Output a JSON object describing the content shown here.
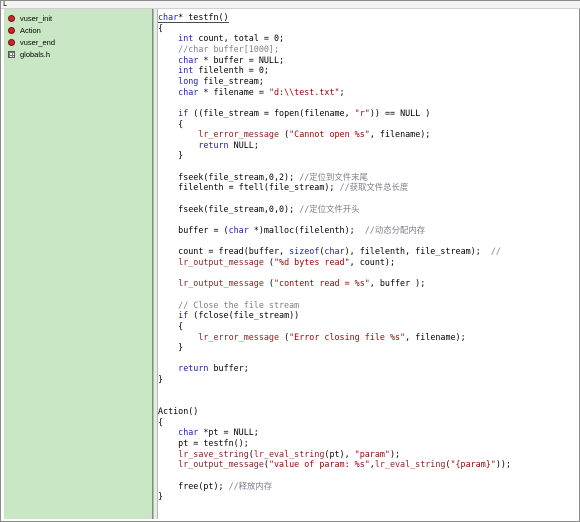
{
  "window": {
    "top_mark": "L"
  },
  "sidebar": {
    "items": [
      {
        "label": "vuser_init",
        "icon": "red-action-icon"
      },
      {
        "label": "Action",
        "icon": "red-action-icon"
      },
      {
        "label": "vuser_end",
        "icon": "red-action-icon"
      },
      {
        "label": "globals.h",
        "icon": "header-file-icon"
      }
    ]
  },
  "editor": {
    "colors": {
      "keyword": "#1b1bb3",
      "string": "#9a0000",
      "comment": "#7f7f8c",
      "function": "#8b1e1e",
      "sidebar_bg": "#c9e7c4"
    },
    "lines": [
      {
        "segments": [
          [
            "kw",
            "char"
          ],
          [
            "",
            "* testfn()"
          ]
        ]
      },
      {
        "segments": [
          [
            "",
            "{"
          ]
        ]
      },
      {
        "segments": [
          [
            "",
            "    "
          ],
          [
            "kw",
            "int"
          ],
          [
            "",
            " count, total = 0;"
          ]
        ]
      },
      {
        "segments": [
          [
            "",
            "    "
          ],
          [
            "cm",
            "//char buffer[1000];"
          ]
        ]
      },
      {
        "segments": [
          [
            "",
            "    "
          ],
          [
            "kw",
            "char"
          ],
          [
            "",
            " * buffer = NULL;"
          ]
        ]
      },
      {
        "segments": [
          [
            "",
            "    "
          ],
          [
            "kw",
            "int"
          ],
          [
            "",
            " filelenth = 0;"
          ]
        ]
      },
      {
        "segments": [
          [
            "",
            "    "
          ],
          [
            "kw",
            "long"
          ],
          [
            "",
            " file_stream;"
          ]
        ]
      },
      {
        "segments": [
          [
            "",
            "    "
          ],
          [
            "kw",
            "char"
          ],
          [
            "",
            " * filename = "
          ],
          [
            "str",
            "\"d:\\\\test.txt\""
          ],
          [
            "",
            ";"
          ]
        ]
      },
      {
        "segments": [
          [
            "",
            ""
          ]
        ]
      },
      {
        "segments": [
          [
            "",
            "    "
          ],
          [
            "kw",
            "if"
          ],
          [
            "",
            " ((file_stream = fopen(filename, "
          ],
          [
            "str",
            "\"r\""
          ],
          [
            "",
            ")) == NULL )"
          ]
        ]
      },
      {
        "segments": [
          [
            "",
            "    {"
          ]
        ]
      },
      {
        "segments": [
          [
            "",
            "        "
          ],
          [
            "fn",
            "lr_error_message"
          ],
          [
            "",
            " ("
          ],
          [
            "str",
            "\"Cannot open %s\""
          ],
          [
            "",
            ", filename);"
          ]
        ]
      },
      {
        "segments": [
          [
            "",
            "        "
          ],
          [
            "kw",
            "return"
          ],
          [
            "",
            " NULL;"
          ]
        ]
      },
      {
        "segments": [
          [
            "",
            "    }"
          ]
        ]
      },
      {
        "segments": [
          [
            "",
            ""
          ]
        ]
      },
      {
        "segments": [
          [
            "",
            "    fseek(file_stream,0,2); "
          ],
          [
            "cm",
            "//定位到文件末尾"
          ]
        ]
      },
      {
        "segments": [
          [
            "",
            "    filelenth = ftell(file_stream); "
          ],
          [
            "cm",
            "//获取文件总长度"
          ]
        ]
      },
      {
        "segments": [
          [
            "",
            ""
          ]
        ]
      },
      {
        "segments": [
          [
            "",
            "    fseek(file_stream,0,0); "
          ],
          [
            "cm",
            "//定位文件开头"
          ]
        ]
      },
      {
        "segments": [
          [
            "",
            ""
          ]
        ]
      },
      {
        "segments": [
          [
            "",
            "    buffer = ("
          ],
          [
            "kw",
            "char"
          ],
          [
            "",
            " *)malloc(filelenth);  "
          ],
          [
            "cm",
            "//动态分配内存"
          ]
        ]
      },
      {
        "segments": [
          [
            "",
            ""
          ]
        ]
      },
      {
        "segments": [
          [
            "",
            "    count = fread(buffer, "
          ],
          [
            "kw",
            "sizeof"
          ],
          [
            "",
            "("
          ],
          [
            "kw",
            "char"
          ],
          [
            "",
            "), filelenth, file_stream);  "
          ],
          [
            "cm",
            "//"
          ]
        ]
      },
      {
        "segments": [
          [
            "",
            "    "
          ],
          [
            "fn",
            "lr_output_message"
          ],
          [
            "",
            " ("
          ],
          [
            "str",
            "\"%d bytes read\""
          ],
          [
            "",
            ", count);"
          ]
        ]
      },
      {
        "segments": [
          [
            "",
            ""
          ]
        ]
      },
      {
        "segments": [
          [
            "",
            "    "
          ],
          [
            "fn",
            "lr_output_message"
          ],
          [
            "",
            " ("
          ],
          [
            "str",
            "\"content read = %s\""
          ],
          [
            "",
            ", buffer );"
          ]
        ]
      },
      {
        "segments": [
          [
            "",
            ""
          ]
        ]
      },
      {
        "segments": [
          [
            "",
            "    "
          ],
          [
            "cm",
            "// Close the file stream"
          ]
        ]
      },
      {
        "segments": [
          [
            "",
            "    "
          ],
          [
            "kw",
            "if"
          ],
          [
            "",
            " (fclose(file_stream))"
          ]
        ]
      },
      {
        "segments": [
          [
            "",
            "    {"
          ]
        ]
      },
      {
        "segments": [
          [
            "",
            "        "
          ],
          [
            "fn",
            "lr_error_message"
          ],
          [
            "",
            " ("
          ],
          [
            "str",
            "\"Error closing file %s\""
          ],
          [
            "",
            ", filename);"
          ]
        ]
      },
      {
        "segments": [
          [
            "",
            "    }"
          ]
        ]
      },
      {
        "segments": [
          [
            "",
            ""
          ]
        ]
      },
      {
        "segments": [
          [
            "",
            "    "
          ],
          [
            "kw",
            "return"
          ],
          [
            "",
            " buffer;"
          ]
        ]
      },
      {
        "segments": [
          [
            "",
            "}"
          ]
        ]
      },
      {
        "segments": [
          [
            "",
            ""
          ]
        ]
      },
      {
        "segments": [
          [
            "",
            ""
          ]
        ]
      },
      {
        "segments": [
          [
            "",
            "Action()"
          ]
        ]
      },
      {
        "segments": [
          [
            "",
            "{"
          ]
        ]
      },
      {
        "segments": [
          [
            "",
            "    "
          ],
          [
            "kw",
            "char"
          ],
          [
            "",
            " *pt = NULL;"
          ]
        ]
      },
      {
        "segments": [
          [
            "",
            "    pt = testfn();"
          ]
        ]
      },
      {
        "segments": [
          [
            "",
            "    "
          ],
          [
            "fn",
            "lr_save_string"
          ],
          [
            "",
            "("
          ],
          [
            "fn",
            "lr_eval_string"
          ],
          [
            "",
            "(pt), "
          ],
          [
            "str",
            "\"param\""
          ],
          [
            "",
            ");"
          ]
        ]
      },
      {
        "segments": [
          [
            "",
            "    "
          ],
          [
            "fn",
            "lr_output_message"
          ],
          [
            "",
            "("
          ],
          [
            "str",
            "\"value of param: %s\""
          ],
          [
            "",
            ","
          ],
          [
            "fn",
            "lr_eval_string"
          ],
          [
            "",
            "("
          ],
          [
            "str",
            "\"{param}\""
          ],
          [
            "",
            "));"
          ]
        ]
      },
      {
        "segments": [
          [
            "",
            ""
          ]
        ]
      },
      {
        "segments": [
          [
            "",
            "    free(pt); "
          ],
          [
            "cm",
            "//释放内存"
          ]
        ]
      },
      {
        "segments": [
          [
            "",
            "}"
          ]
        ]
      }
    ]
  }
}
